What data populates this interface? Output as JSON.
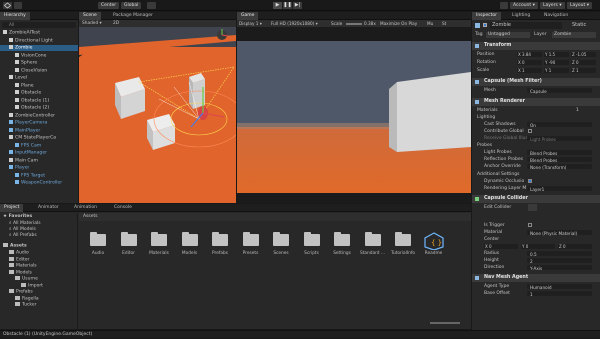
{
  "toolbar": {
    "account_label": "Account",
    "layers_label": "Layers",
    "layout_label": "Layout",
    "pivot_label": "Center",
    "space_label": "Global",
    "play_icon": "play-icon",
    "pause_icon": "pause-icon",
    "step_icon": "step-icon"
  },
  "hierarchy": {
    "tab_label": "Hierarchy",
    "search_placeholder": "All",
    "items": [
      {
        "label": "ZombieAITest",
        "indent": 0,
        "selected": false,
        "prefab": false
      },
      {
        "label": "Directional Light",
        "indent": 1,
        "selected": false,
        "prefab": false
      },
      {
        "label": "Zombie",
        "indent": 1,
        "selected": true,
        "prefab": false
      },
      {
        "label": "VisionCone",
        "indent": 2,
        "selected": false,
        "prefab": false
      },
      {
        "label": "Sphere",
        "indent": 2,
        "selected": false,
        "prefab": false
      },
      {
        "label": "CloseVision",
        "indent": 2,
        "selected": false,
        "prefab": false
      },
      {
        "label": "Level",
        "indent": 1,
        "selected": false,
        "prefab": false
      },
      {
        "label": "Plane",
        "indent": 2,
        "selected": false,
        "prefab": false
      },
      {
        "label": "Obstacle",
        "indent": 2,
        "selected": false,
        "prefab": false
      },
      {
        "label": "Obstacle (1)",
        "indent": 2,
        "selected": false,
        "prefab": false
      },
      {
        "label": "Obstacle (2)",
        "indent": 2,
        "selected": false,
        "prefab": false
      },
      {
        "label": "ZombieController",
        "indent": 1,
        "selected": false,
        "prefab": false
      },
      {
        "label": "PlayerCamera",
        "indent": 1,
        "selected": false,
        "prefab": true
      },
      {
        "label": "MainPlayer",
        "indent": 1,
        "selected": false,
        "prefab": true
      },
      {
        "label": "CM StatePlayerCa",
        "indent": 1,
        "selected": false,
        "prefab": false
      },
      {
        "label": "FPS Cam",
        "indent": 2,
        "selected": false,
        "prefab": true
      },
      {
        "label": "InputManager",
        "indent": 1,
        "selected": false,
        "prefab": true
      },
      {
        "label": "Main Cam",
        "indent": 1,
        "selected": false,
        "prefab": false
      },
      {
        "label": "Player",
        "indent": 1,
        "selected": false,
        "prefab": true
      },
      {
        "label": "FPS Target",
        "indent": 2,
        "selected": false,
        "prefab": true
      },
      {
        "label": "WeaponController",
        "indent": 2,
        "selected": false,
        "prefab": true
      }
    ]
  },
  "scene": {
    "tabs": [
      "Scene",
      "Package Manager"
    ],
    "shading": "Shaded",
    "mode_2d": "2D"
  },
  "game": {
    "tab_label": "Game",
    "display": "Display 1",
    "resolution": "Full HD (1920x1080)",
    "scale_label": "Scale",
    "scale_value": "0.38x",
    "maximize_label": "Maximize On Play",
    "mute_label": "Mu",
    "stats_label": "St"
  },
  "inspector": {
    "tabs": [
      "Inspector",
      "Lighting",
      "Navigation"
    ],
    "object_name": "Zombie",
    "static_label": "Static",
    "tag_label": "Tag",
    "tag_value": "Untagged",
    "layer_label": "Layer",
    "layer_value": "Zombie",
    "transform": {
      "title": "Transform",
      "position_label": "Position",
      "position": [
        "X 3.84",
        "Y 1.5",
        "Z -1.05"
      ],
      "rotation_label": "Rotation",
      "rotation": [
        "X 0",
        "Y -90",
        "Z 0"
      ],
      "scale_label": "Scale",
      "scale": [
        "X 1",
        "Y 1",
        "Z 1"
      ]
    },
    "mesh_filter": {
      "title": "Capsule (Mesh Filter)",
      "mesh_label": "Mesh",
      "mesh_value": "Capsule"
    },
    "mesh_renderer": {
      "title": "Mesh Renderer",
      "materials_label": "Materials",
      "materials_value": "1",
      "lighting_label": "Lighting",
      "cast_shadows_label": "Cast Shadows",
      "cast_shadows_value": "On",
      "contribute_gi_label": "Contribute Global",
      "receive_gi_label": "Receive Global Illum",
      "receive_gi_value": "Light Probes",
      "probes_label": "Probes",
      "light_probes_label": "Light Probes",
      "light_probes_value": "Blend Probes",
      "reflection_probes_label": "Reflection Probes",
      "reflection_probes_value": "Blend Probes",
      "anchor_override_label": "Anchor Override",
      "anchor_override_value": "None (Transform)",
      "additional_label": "Additional Settings",
      "dynamic_occlusion_label": "Dynamic Occlusio",
      "rendering_layer_label": "Rendering Layer M",
      "rendering_layer_value": "Layer1"
    },
    "capsule_collider": {
      "title": "Capsule Collider",
      "edit_collider_label": "Edit Collider",
      "is_trigger_label": "Is Trigger",
      "material_label": "Material",
      "material_value": "None (Physic Material)",
      "center_label": "Center",
      "center": [
        "X 0",
        "Y 0",
        "Z 0"
      ],
      "radius_label": "Radius",
      "radius_value": "0.5",
      "height_label": "Height",
      "height_value": "2",
      "direction_label": "Direction",
      "direction_value": "Y-Axis"
    },
    "nav_mesh_agent": {
      "title": "Nav Mesh Agent",
      "agent_type_label": "Agent Type",
      "agent_type_value": "Humanoid",
      "base_offset_label": "Base Offset",
      "base_offset_value": "1"
    }
  },
  "project": {
    "tabs": [
      "Project",
      "Animator",
      "Animation",
      "Console"
    ],
    "favorites_label": "Favorites",
    "favorites": [
      "All Materials",
      "All Models",
      "All Prefabs"
    ],
    "assets_label": "Assets",
    "tree": [
      {
        "label": "Audio",
        "indent": 1
      },
      {
        "label": "Editor",
        "indent": 1
      },
      {
        "label": "Materials",
        "indent": 1
      },
      {
        "label": "Models",
        "indent": 1
      },
      {
        "label": "Usurne",
        "indent": 2
      },
      {
        "label": "Import",
        "indent": 3
      },
      {
        "label": "Prefabs",
        "indent": 1
      },
      {
        "label": "Ragella",
        "indent": 2
      },
      {
        "label": "Tucker",
        "indent": 2
      }
    ],
    "breadcrumb": "Assets",
    "folders": [
      "Audio",
      "Editor",
      "Materials",
      "Models",
      "Prefabs",
      "Presets",
      "Scenes",
      "Scripts",
      "Settings",
      "Standard ...",
      "TutorialInfo",
      "Readme"
    ]
  },
  "status_bar": {
    "text": "Obstacle (1) (UnityEngine.GameObject)"
  },
  "colors": {
    "selection": "#2c5d87",
    "ground": "#e0642c",
    "sky": "#4f5869",
    "panel": "#282828"
  }
}
